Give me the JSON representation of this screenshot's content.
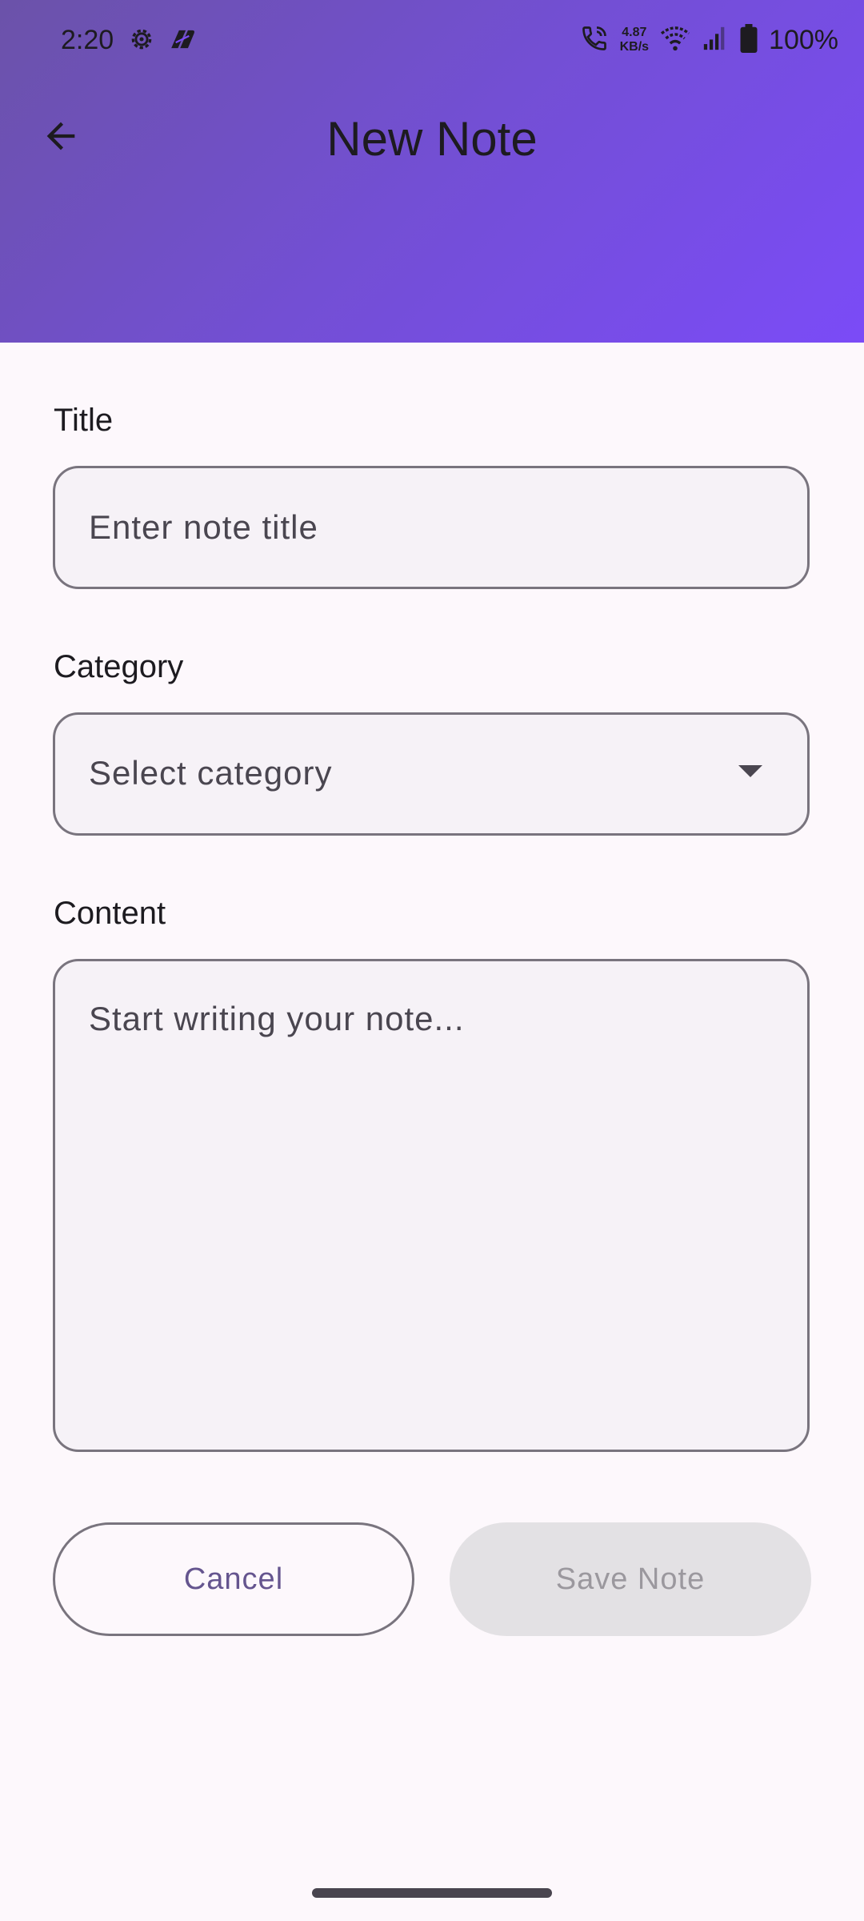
{
  "status_bar": {
    "time": "2:20",
    "left_icons": [
      "settings-gear-icon",
      "app-notification-icon"
    ],
    "net_speed_value": "4.87",
    "net_speed_unit": "KB/s",
    "right_icons": [
      "wifi-calling-icon",
      "wifi-icon",
      "cellular-signal-icon",
      "battery-icon"
    ],
    "battery_percent": "100%"
  },
  "header": {
    "title": "New Note",
    "back_icon": "arrow-back-icon",
    "gradient_colors": [
      "#6b52a9",
      "#7b4bf7"
    ]
  },
  "form": {
    "title_field": {
      "label": "Title",
      "placeholder": "Enter note title",
      "value": ""
    },
    "category_field": {
      "label": "Category",
      "placeholder": "Select category",
      "icon": "dropdown-arrow-icon"
    },
    "content_field": {
      "label": "Content",
      "placeholder": "Start writing your note...",
      "value": ""
    }
  },
  "actions": {
    "cancel_label": "Cancel",
    "save_label": "Save Note",
    "save_enabled": false
  },
  "colors": {
    "background": "#fdf8fc",
    "field_fill": "#f6f2f7",
    "outline": "#79747e",
    "primary_text": "#65558f",
    "disabled_fill": "#e3e1e4"
  }
}
